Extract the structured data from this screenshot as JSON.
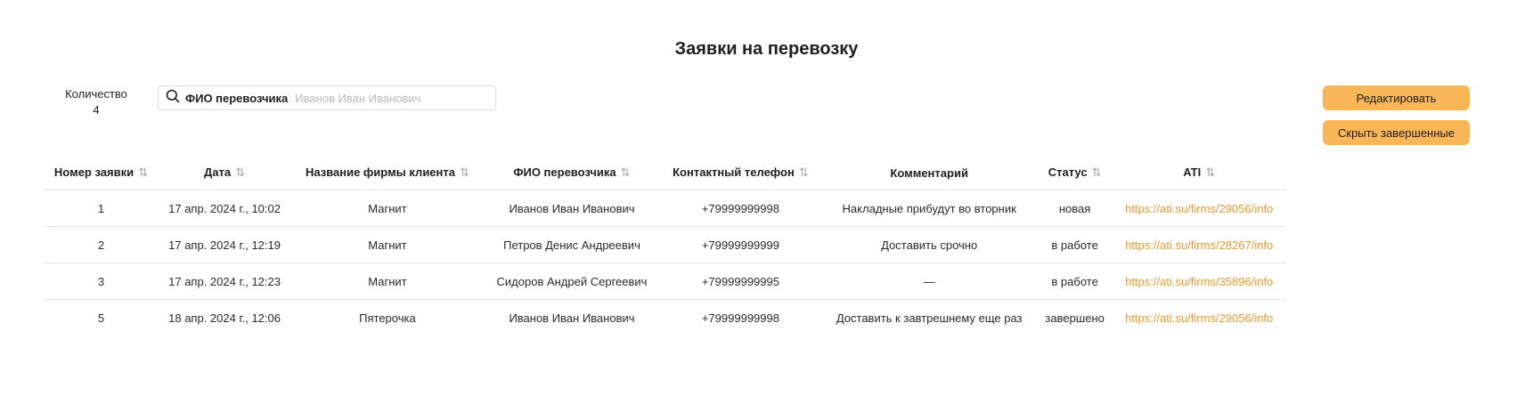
{
  "page": {
    "title": "Заявки на перевозку"
  },
  "summary": {
    "count_label": "Количество",
    "count_value": "4"
  },
  "search": {
    "field_label": "ФИО перевозчика",
    "placeholder": "Иванов Иван Иванович",
    "value": ""
  },
  "actions": {
    "edit_label": "Редактировать",
    "hide_completed_label": "Скрыть завершенные"
  },
  "table": {
    "columns": [
      {
        "label": "Номер заявки",
        "sortable": true
      },
      {
        "label": "Дата",
        "sortable": true
      },
      {
        "label": "Название фирмы клиента",
        "sortable": true
      },
      {
        "label": "ФИО перевозчика",
        "sortable": true
      },
      {
        "label": "Контактный телефон",
        "sortable": true
      },
      {
        "label": "Комментарий",
        "sortable": false
      },
      {
        "label": "Статус",
        "sortable": true
      },
      {
        "label": "ATI",
        "sortable": true
      }
    ],
    "rows": [
      {
        "number": "1",
        "date": "17 апр. 2024 г., 10:02",
        "client": "Магнит",
        "carrier": "Иванов Иван Иванович",
        "phone": "+79999999998",
        "comment": "Накладные прибудут во вторник",
        "status": "новая",
        "ati": "https://ati.su/firms/29056/info"
      },
      {
        "number": "2",
        "date": "17 апр. 2024 г., 12:19",
        "client": "Магнит",
        "carrier": "Петров Денис Андреевич",
        "phone": "+79999999999",
        "comment": "Доставить срочно",
        "status": "в работе",
        "ati": "https://ati.su/firms/28267/info"
      },
      {
        "number": "3",
        "date": "17 апр. 2024 г., 12:23",
        "client": "Магнит",
        "carrier": "Сидоров Андрей Сергеевич",
        "phone": "+79999999995",
        "comment": "—",
        "status": "в работе",
        "ati": "https://ati.su/firms/35896/info"
      },
      {
        "number": "5",
        "date": "18 апр. 2024 г., 12:06",
        "client": "Пятерочка",
        "carrier": "Иванов Иван Иванович",
        "phone": "+79999999998",
        "comment": "Доставить к завтрешнему еще раз",
        "status": "завершено",
        "ati": "https://ati.su/firms/29056/info"
      }
    ]
  },
  "icons": {
    "search": "search-icon",
    "sort": "sort-arrows-icon"
  },
  "colors": {
    "accent": "#f9b657",
    "link": "#e39a32",
    "divider": "#e4e4e4"
  }
}
